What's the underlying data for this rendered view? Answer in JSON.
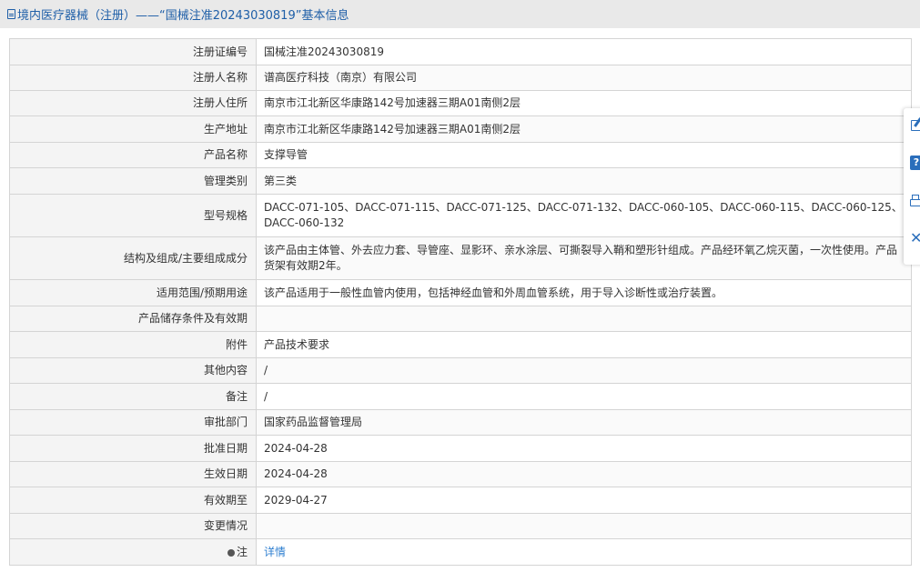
{
  "header": {
    "title": "境内医疗器械（注册）——“国械注准20243030819”基本信息"
  },
  "rows": [
    {
      "label": "注册证编号",
      "value": "国械注准20243030819"
    },
    {
      "label": "注册人名称",
      "value": "谱高医疗科技（南京）有限公司"
    },
    {
      "label": "注册人住所",
      "value": "南京市江北新区华康路142号加速器三期A01南侧2层"
    },
    {
      "label": "生产地址",
      "value": "南京市江北新区华康路142号加速器三期A01南侧2层"
    },
    {
      "label": "产品名称",
      "value": "支撑导管"
    },
    {
      "label": "管理类别",
      "value": "第三类"
    },
    {
      "label": "型号规格",
      "value": "DACC-071-105、DACC-071-115、DACC-071-125、DACC-071-132、DACC-060-105、DACC-060-115、DACC-060-125、DACC-060-132"
    },
    {
      "label": "结构及组成/主要组成成分",
      "value": "该产品由主体管、外去应力套、导管座、显影环、亲水涂层、可撕裂导入鞘和塑形针组成。产品经环氧乙烷灭菌，一次性使用。产品货架有效期2年。"
    },
    {
      "label": "适用范围/预期用途",
      "value": "该产品适用于一般性血管内使用，包括神经血管和外周血管系统，用于导入诊断性或治疗装置。"
    },
    {
      "label": "产品储存条件及有效期",
      "value": ""
    },
    {
      "label": "附件",
      "value": "产品技术要求"
    },
    {
      "label": "其他内容",
      "value": "/"
    },
    {
      "label": "备注",
      "value": "/"
    },
    {
      "label": "审批部门",
      "value": "国家药品监督管理局"
    },
    {
      "label": "批准日期",
      "value": "2024-04-28"
    },
    {
      "label": "生效日期",
      "value": "2024-04-28"
    },
    {
      "label": "有效期至",
      "value": "2029-04-27"
    },
    {
      "label": "变更情况",
      "value": ""
    }
  ],
  "note_row": {
    "label": "注",
    "value": "详情"
  },
  "side_tools": [
    {
      "name": "edit-icon"
    },
    {
      "name": "help-icon",
      "glyph": "?"
    },
    {
      "name": "print-icon"
    },
    {
      "name": "close-icon",
      "glyph": "✕"
    }
  ]
}
